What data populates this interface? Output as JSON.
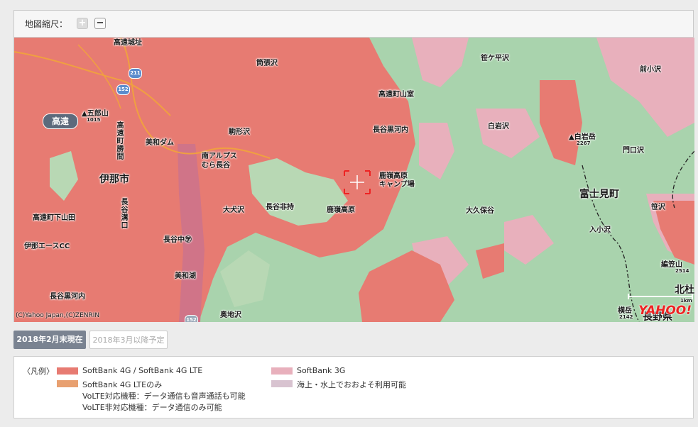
{
  "zoom": {
    "label": "地図縮尺：",
    "zoom_in": "+",
    "zoom_out": "−"
  },
  "colors": {
    "sb4g": "#e77b72",
    "lte_only": "#e8a070",
    "sb3g": "#e8b0bc",
    "sea": "#d8c3d0",
    "terrain": "#a9d3ad"
  },
  "map": {
    "highway_badge": "高遠",
    "places": [
      {
        "id": "takato-jo",
        "text": "高遠城址"
      },
      {
        "id": "tsutsuharasawa",
        "text": "筒張沢"
      },
      {
        "id": "sasagadaira",
        "text": "笹ケ平沢"
      },
      {
        "id": "maekosawa",
        "text": "前小沢"
      },
      {
        "id": "goromaru",
        "text": "▲五郎山"
      },
      {
        "id": "goromaru-elev",
        "text": "1015"
      },
      {
        "id": "takato-yamamuro",
        "text": "高遠町山室"
      },
      {
        "id": "hasekurokawachi",
        "text": "長谷黒河内"
      },
      {
        "id": "shiraiwazawa",
        "text": "白岩沢"
      },
      {
        "id": "shiraiwadake",
        "text": "▲白岩岳"
      },
      {
        "id": "shiraiwadake-elev",
        "text": "2267"
      },
      {
        "id": "monkuchizawa",
        "text": "門口沢"
      },
      {
        "id": "miwa-dam",
        "text": "美和ダム"
      },
      {
        "id": "komagata",
        "text": "駒形沢"
      },
      {
        "id": "alps",
        "text": "南アルプス"
      },
      {
        "id": "alps2",
        "text": "むら長谷"
      },
      {
        "id": "inashi",
        "text": "伊那市"
      },
      {
        "id": "takatomachi-katsuma",
        "text": "高遠町勝間"
      },
      {
        "id": "rokurei-camp",
        "text": "鹿嶺高原"
      },
      {
        "id": "rokurei-camp2",
        "text": "キャンプ場"
      },
      {
        "id": "fujimimachi",
        "text": "富士見町"
      },
      {
        "id": "ooinusawa",
        "text": "大犬沢"
      },
      {
        "id": "hasehimochi",
        "text": "長谷非持"
      },
      {
        "id": "rokurei",
        "text": "鹿嶺高原"
      },
      {
        "id": "ookubo",
        "text": "大久保谷"
      },
      {
        "id": "sazawa",
        "text": "笹沢"
      },
      {
        "id": "takato-shimoyamada",
        "text": "高遠町下山田"
      },
      {
        "id": "hase-mizoguchi",
        "text": "長谷溝口"
      },
      {
        "id": "koirizawa",
        "text": "入小沢"
      },
      {
        "id": "ina-ace",
        "text": "伊那エースCC"
      },
      {
        "id": "hasenaka",
        "text": "長谷中㊫"
      },
      {
        "id": "henkozan",
        "text": "編笠山"
      },
      {
        "id": "henkozan-elev",
        "text": "2514"
      },
      {
        "id": "miwako",
        "text": "美和湖"
      },
      {
        "id": "hasekurokawachi2",
        "text": "長谷黒河内"
      },
      {
        "id": "kitamori",
        "text": "北杜"
      },
      {
        "id": "okujisawa",
        "text": "奥地沢"
      },
      {
        "id": "yokodake",
        "text": "横岳"
      },
      {
        "id": "yokodake-elev",
        "text": "2142"
      },
      {
        "id": "naganoken",
        "text": "長野県"
      },
      {
        "id": "scale",
        "text": "1km"
      }
    ],
    "routes": [
      "211",
      "152",
      "152"
    ],
    "copyright": "(C)Yahoo Japan,(C)ZENRIN",
    "logo": "YAHOO!"
  },
  "tabs": {
    "current": "2018年2月末現在",
    "planned": "2018年3月以降予定"
  },
  "legend": {
    "title": "〈凡例〉",
    "items": [
      {
        "label": "SoftBank 4G / SoftBank 4G LTE"
      },
      {
        "label": "SoftBank 4G LTEのみ"
      },
      {
        "label": "VoLTE対応機種：データ通信も音声通話も可能"
      },
      {
        "label": "VoLTE非対応機種：データ通信のみ可能"
      },
      {
        "label": "SoftBank 3G"
      },
      {
        "label": "海上・水上でおおよそ利用可能"
      }
    ]
  }
}
